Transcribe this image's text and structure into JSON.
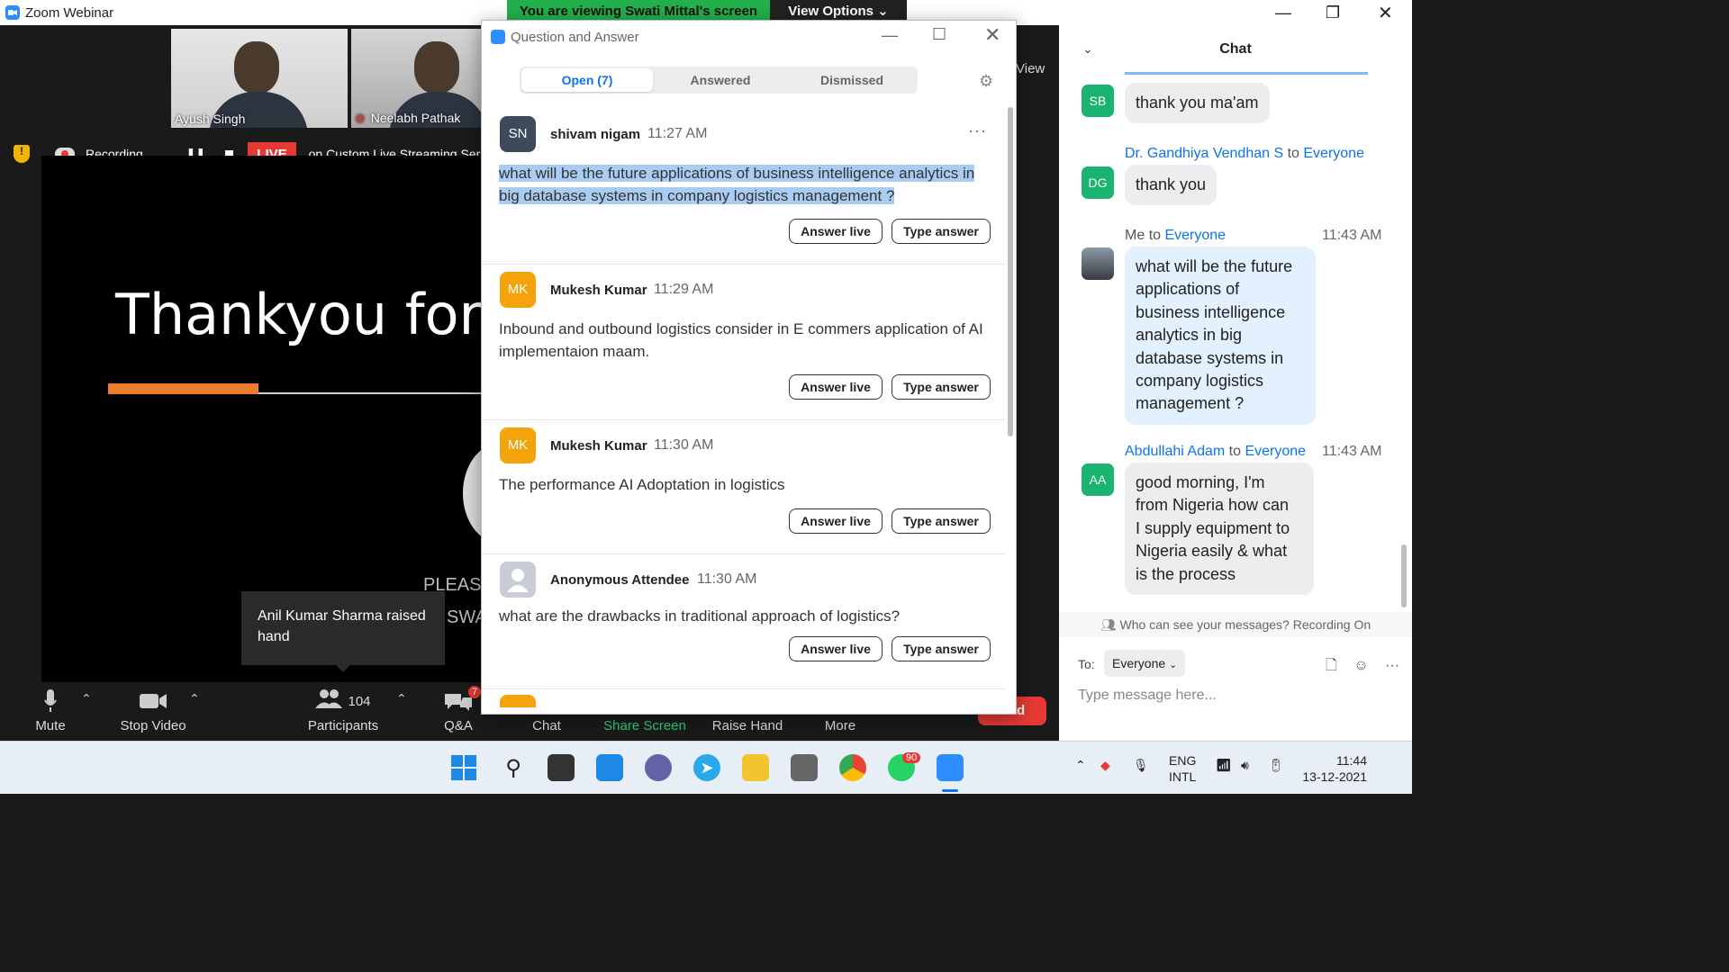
{
  "window": {
    "title": "Zoom Webinar"
  },
  "banner": {
    "viewing": "You are viewing Swati Mittal's screen",
    "view_options": "View Options ⌄",
    "gallery": "View"
  },
  "participants_strip": [
    {
      "name": "Ayush Singh",
      "muted": false
    },
    {
      "name": "Neelabh Pathak",
      "muted": true
    }
  ],
  "recording": {
    "label": "Recording...",
    "live_badge": "LIVE",
    "stream_text": "on Custom Live Streaming Ser"
  },
  "slide": {
    "title": "Thankyou for y",
    "please": "PLEASE",
    "swa": "SWA"
  },
  "toast": {
    "text": "Anil Kumar Sharma raised hand"
  },
  "toolbar": {
    "mute": "Mute",
    "stop_video": "Stop Video",
    "participants": "Participants",
    "participants_count": "104",
    "qa": "Q&A",
    "qa_badge": "7",
    "chat": "Chat",
    "share_screen": "Share Screen",
    "raise_hand": "Raise Hand",
    "more": "More",
    "end": "End"
  },
  "qa": {
    "title": "Question and Answer",
    "tabs": [
      "Open (7)",
      "Answered",
      "Dismissed"
    ],
    "answer_live": "Answer live",
    "type_answer": "Type answer",
    "questions": [
      {
        "initials": "SN",
        "color": "#3d4a5c",
        "name": "shivam nigam",
        "time": "11:27 AM",
        "text": "what will be the future applications of business intelligence analytics in big database systems in company logistics management ?"
      },
      {
        "initials": "MK",
        "color": "#f5a30b",
        "name": "Mukesh Kumar",
        "time": "11:29 AM",
        "text": "Inbound and outbound logistics consider in E commers application of AI implementaion maam."
      },
      {
        "initials": "MK",
        "color": "#f5a30b",
        "name": "Mukesh Kumar",
        "time": "11:30 AM",
        "text": "The performance AI Adoptation in logistics"
      },
      {
        "initials": "",
        "color": "#c9cdd6",
        "name": "Anonymous Attendee",
        "time": "11:30 AM",
        "text": "what are the drawbacks in traditional approach of logistics?"
      }
    ]
  },
  "chat": {
    "title": "Chat",
    "messages": [
      {
        "initials": "SB",
        "text": "thank you ma'am"
      },
      {
        "initials": "DG",
        "from": "Dr. Gandhiya Vendhan S",
        "to_word": "to",
        "to": "Everyone",
        "text": "thank you"
      },
      {
        "initials": "",
        "from": "Me",
        "to_word": "to",
        "to": "Everyone",
        "time": "11:43 AM",
        "lines": [
          "what will be the future",
          "applications of",
          "business intelligence",
          "analytics in big",
          "database systems in",
          "company logistics",
          "management ?"
        ]
      },
      {
        "initials": "AA",
        "from": "Abdullahi Adam",
        "to_word": "to",
        "to": "Everyone",
        "time": "11:43 AM",
        "lines": [
          "good morning,  I'm",
          "from Nigeria  how can",
          "I supply equipment to",
          "Nigeria easily & what",
          "is the process"
        ]
      }
    ],
    "privacy": "Who can see your messages? Recording On",
    "to_label": "To:",
    "to_value": "Everyone",
    "placeholder": "Type message here..."
  },
  "taskbar": {
    "whatsapp_badge": "90",
    "lang1": "ENG",
    "lang2": "INTL",
    "time": "11:44",
    "date": "13-12-2021"
  }
}
